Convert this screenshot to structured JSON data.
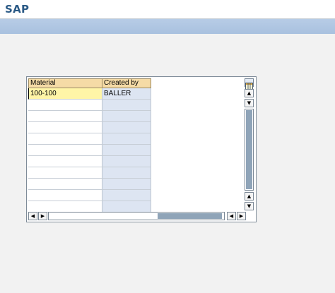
{
  "app": {
    "title": "SAP"
  },
  "grid": {
    "columns": [
      "Material",
      "Created by"
    ],
    "rows": [
      [
        "100-100",
        "BALLER"
      ],
      [
        "",
        ""
      ],
      [
        "",
        ""
      ],
      [
        "",
        ""
      ],
      [
        "",
        ""
      ],
      [
        "",
        ""
      ],
      [
        "",
        ""
      ],
      [
        "",
        ""
      ],
      [
        "",
        ""
      ],
      [
        "",
        ""
      ],
      [
        "",
        ""
      ]
    ],
    "active_row": 0,
    "horizontal_scroll_position": 0.62
  },
  "icons": {
    "layout": "column-layout-icon",
    "scroll_up": "triangle-up-icon",
    "scroll_down": "triangle-down-icon",
    "scroll_left": "triangle-left-icon",
    "scroll_right": "triangle-right-icon"
  },
  "colors": {
    "title": "#2b5a86",
    "toolbar": "#afc6e2",
    "header": "#f5dba6",
    "selected_cell": "#fff5a7",
    "key_column": "#dde5f2",
    "scroll_thumb": "#8fa4b8"
  }
}
